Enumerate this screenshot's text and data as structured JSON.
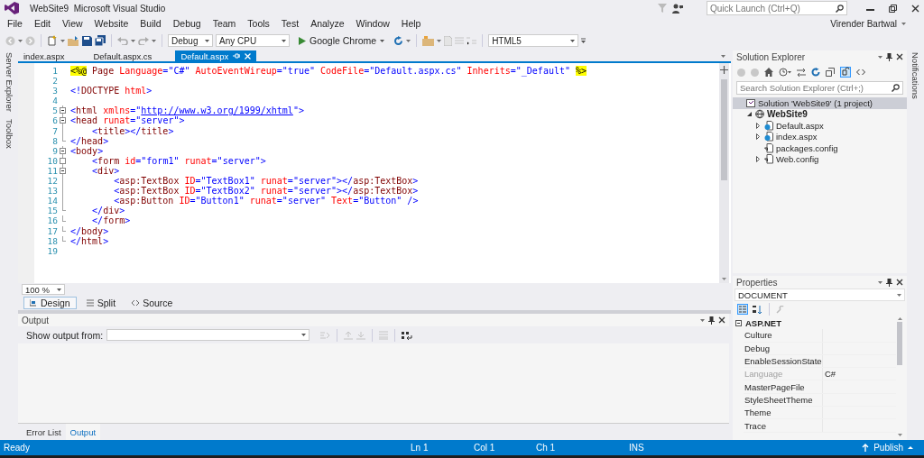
{
  "window": {
    "title": "WebSite9  Microsoft Visual Studio",
    "quick_launch": {
      "placeholder": "Quick Launch (Ctrl+Q)"
    },
    "user": "Virender Bartwal"
  },
  "menu": [
    "File",
    "Edit",
    "View",
    "Website",
    "Build",
    "Debug",
    "Team",
    "Tools",
    "Test",
    "Analyze",
    "Window",
    "Help"
  ],
  "toolbar": {
    "configuration": "Debug",
    "platform": "Any CPU",
    "run_target": "Google Chrome",
    "schema": "HTML5"
  },
  "side_tabs_left": [
    "Server Explorer",
    "Toolbox"
  ],
  "side_tabs_right": [
    "Notifications"
  ],
  "document_tabs": [
    {
      "label": "index.aspx",
      "selected": false
    },
    {
      "label": "Default.aspx.cs",
      "selected": false
    },
    {
      "label": "Default.aspx",
      "selected": true
    }
  ],
  "editor": {
    "lines": [
      {
        "number": "1",
        "kind": "plain",
        "tokens": [
          {
            "kind": "directive",
            "text": "<%@"
          },
          {
            "kind": "tag",
            "text": " Page "
          },
          {
            "kind": "attr",
            "text": "Language"
          },
          {
            "kind": "delim",
            "text": "="
          },
          {
            "kind": "value",
            "text": "\"C#\" "
          },
          {
            "kind": "attr",
            "text": "AutoEventWireup"
          },
          {
            "kind": "delim",
            "text": "="
          },
          {
            "kind": "value",
            "text": "\"true\" "
          },
          {
            "kind": "attr",
            "text": "CodeFile"
          },
          {
            "kind": "delim",
            "text": "="
          },
          {
            "kind": "value",
            "text": "\"Default.aspx.cs\" "
          },
          {
            "kind": "attr",
            "text": "Inherits"
          },
          {
            "kind": "delim",
            "text": "="
          },
          {
            "kind": "value",
            "text": "\"_Default\" "
          },
          {
            "kind": "directive",
            "text": "%>"
          }
        ]
      },
      {
        "number": "2",
        "kind": "plain"
      },
      {
        "number": "3",
        "kind": "plain",
        "tokens": [
          {
            "kind": "delim",
            "text": "<!"
          },
          {
            "kind": "tag",
            "text": "DOCTYPE "
          },
          {
            "kind": "attr",
            "text": "html"
          },
          {
            "kind": "delim",
            "text": ">"
          }
        ]
      },
      {
        "number": "4",
        "kind": "plain"
      },
      {
        "number": "5",
        "kind": "fold-start",
        "tokens": [
          {
            "kind": "delim",
            "text": "<"
          },
          {
            "kind": "tag",
            "text": "html "
          },
          {
            "kind": "attr",
            "text": "xmlns"
          },
          {
            "kind": "delim",
            "text": "=\""
          },
          {
            "kind": "link",
            "text": "http://www.w3.org/1999/xhtml"
          },
          {
            "kind": "delim",
            "text": "\">"
          }
        ]
      },
      {
        "number": "6",
        "kind": "fold-start",
        "tokens": [
          {
            "kind": "delim",
            "text": "<"
          },
          {
            "kind": "tag",
            "text": "head "
          },
          {
            "kind": "attr",
            "text": "runat"
          },
          {
            "kind": "delim",
            "text": "="
          },
          {
            "kind": "value",
            "text": "\"server\""
          },
          {
            "kind": "delim",
            "text": ">"
          }
        ]
      },
      {
        "number": "7",
        "kind": "inside",
        "tokens": [
          {
            "kind": "delim",
            "text": "    <"
          },
          {
            "kind": "tag",
            "text": "title"
          },
          {
            "kind": "delim",
            "text": "></"
          },
          {
            "kind": "tag",
            "text": "title"
          },
          {
            "kind": "delim",
            "text": ">"
          }
        ]
      },
      {
        "number": "8",
        "kind": "fold-end",
        "tokens": [
          {
            "kind": "delim",
            "text": "</"
          },
          {
            "kind": "tag",
            "text": "head"
          },
          {
            "kind": "delim",
            "text": ">"
          }
        ]
      },
      {
        "number": "9",
        "kind": "fold-start",
        "tokens": [
          {
            "kind": "delim",
            "text": "<"
          },
          {
            "kind": "tag",
            "text": "body"
          },
          {
            "kind": "delim",
            "text": ">"
          }
        ]
      },
      {
        "number": "10",
        "kind": "fold-box",
        "tokens": [
          {
            "kind": "delim",
            "text": "    <"
          },
          {
            "kind": "tag",
            "text": "form "
          },
          {
            "kind": "attr",
            "text": "id"
          },
          {
            "kind": "delim",
            "text": "="
          },
          {
            "kind": "value",
            "text": "\"form1\" "
          },
          {
            "kind": "attr",
            "text": "runat"
          },
          {
            "kind": "delim",
            "text": "="
          },
          {
            "kind": "value",
            "text": "\"server\""
          },
          {
            "kind": "delim",
            "text": ">"
          }
        ]
      },
      {
        "number": "11",
        "kind": "fold-start",
        "tokens": [
          {
            "kind": "delim",
            "text": "    <"
          },
          {
            "kind": "tag",
            "text": "div"
          },
          {
            "kind": "delim",
            "text": ">"
          }
        ]
      },
      {
        "number": "12",
        "kind": "inside",
        "tokens": [
          {
            "kind": "delim",
            "text": "        <"
          },
          {
            "kind": "tag",
            "text": "asp:TextBox "
          },
          {
            "kind": "attr",
            "text": "ID"
          },
          {
            "kind": "delim",
            "text": "="
          },
          {
            "kind": "value",
            "text": "\"TextBox1\" "
          },
          {
            "kind": "attr",
            "text": "runat"
          },
          {
            "kind": "delim",
            "text": "="
          },
          {
            "kind": "value",
            "text": "\"server\""
          },
          {
            "kind": "delim",
            "text": "></"
          },
          {
            "kind": "tag",
            "text": "asp:TextBox"
          },
          {
            "kind": "delim",
            "text": ">"
          }
        ]
      },
      {
        "number": "13",
        "kind": "inside",
        "tokens": [
          {
            "kind": "delim",
            "text": "        <"
          },
          {
            "kind": "tag",
            "text": "asp:TextBox "
          },
          {
            "kind": "attr",
            "text": "ID"
          },
          {
            "kind": "delim",
            "text": "="
          },
          {
            "kind": "value",
            "text": "\"TextBox2\" "
          },
          {
            "kind": "attr",
            "text": "runat"
          },
          {
            "kind": "delim",
            "text": "="
          },
          {
            "kind": "value",
            "text": "\"server\""
          },
          {
            "kind": "delim",
            "text": "></"
          },
          {
            "kind": "tag",
            "text": "asp:TextBox"
          },
          {
            "kind": "delim",
            "text": ">"
          }
        ]
      },
      {
        "number": "14",
        "kind": "inside",
        "tokens": [
          {
            "kind": "delim",
            "text": "        <"
          },
          {
            "kind": "tag",
            "text": "asp:Button "
          },
          {
            "kind": "attr",
            "text": "ID"
          },
          {
            "kind": "delim",
            "text": "="
          },
          {
            "kind": "value",
            "text": "\"Button1\" "
          },
          {
            "kind": "attr",
            "text": "runat"
          },
          {
            "kind": "delim",
            "text": "="
          },
          {
            "kind": "value",
            "text": "\"server\" "
          },
          {
            "kind": "attr",
            "text": "Text"
          },
          {
            "kind": "delim",
            "text": "="
          },
          {
            "kind": "value",
            "text": "\"Button\""
          },
          {
            "kind": "delim",
            "text": " />"
          }
        ]
      },
      {
        "number": "15",
        "kind": "fold-end",
        "tokens": [
          {
            "kind": "delim",
            "text": "    </"
          },
          {
            "kind": "tag",
            "text": "div"
          },
          {
            "kind": "delim",
            "text": ">"
          }
        ]
      },
      {
        "number": "16",
        "kind": "fold-end",
        "tokens": [
          {
            "kind": "delim",
            "text": "    </"
          },
          {
            "kind": "tag",
            "text": "form"
          },
          {
            "kind": "delim",
            "text": ">"
          }
        ]
      },
      {
        "number": "17",
        "kind": "fold-end",
        "tokens": [
          {
            "kind": "delim",
            "text": "</"
          },
          {
            "kind": "tag",
            "text": "body"
          },
          {
            "kind": "delim",
            "text": ">"
          }
        ]
      },
      {
        "number": "18",
        "kind": "fold-end",
        "tokens": [
          {
            "kind": "delim",
            "text": "</"
          },
          {
            "kind": "tag",
            "text": "html"
          },
          {
            "kind": "delim",
            "text": ">"
          }
        ]
      },
      {
        "number": "19",
        "kind": "plain"
      }
    ],
    "zoom": "100 %",
    "view_tabs": [
      {
        "label": "Design",
        "selected": true
      },
      {
        "label": "Split",
        "selected": false
      },
      {
        "label": "Source",
        "selected": false
      }
    ]
  },
  "output": {
    "title": "Output",
    "source_label": "Show output from:",
    "tabs": [
      {
        "label": "Error List",
        "selected": false
      },
      {
        "label": "Output",
        "selected": true
      }
    ]
  },
  "solution_explorer": {
    "title": "Solution Explorer",
    "search_placeholder": "Search Solution Explorer (Ctrl+;)",
    "tree": [
      {
        "label": "Solution 'WebSite9' (1 project)",
        "kind": "solution",
        "selected": true,
        "children": [
          {
            "label": "WebSite9",
            "kind": "website",
            "selected": false,
            "expanded": true,
            "children": [
              {
                "label": "Default.aspx",
                "kind": "page",
                "selected": false,
                "expanded": false
              },
              {
                "label": "index.aspx",
                "kind": "page",
                "selected": false,
                "expanded": false
              },
              {
                "label": "packages.config",
                "kind": "config",
                "selected": false
              },
              {
                "label": "Web.config",
                "kind": "config",
                "selected": false,
                "expanded": false
              }
            ]
          }
        ]
      }
    ]
  },
  "properties": {
    "title": "Properties",
    "object": "DOCUMENT",
    "categories": [
      {
        "label": "ASP.NET",
        "expanded": true,
        "rows": [
          {
            "name": "Culture",
            "disabled": false
          },
          {
            "name": "Debug",
            "disabled": false
          },
          {
            "name": "EnableSessionState",
            "disabled": false
          },
          {
            "name": "Language",
            "value": "C#",
            "disabled": true
          },
          {
            "name": "MasterPageFile",
            "disabled": false
          },
          {
            "name": "StyleSheetTheme",
            "disabled": false
          },
          {
            "name": "Theme",
            "disabled": false
          },
          {
            "name": "Trace",
            "disabled": false
          }
        ]
      }
    ]
  },
  "status_bar": {
    "message": "Ready",
    "line": "Ln 1",
    "column": "Col 1",
    "char": "Ch 1",
    "mode": "INS",
    "publish": "Publish"
  }
}
